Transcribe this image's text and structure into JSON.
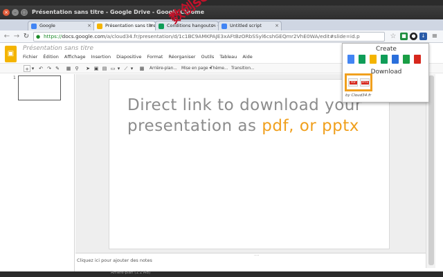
{
  "window": {
    "title": "Présentation sans titre - Google Drive - Google Chrome",
    "controls": [
      "×",
      "–",
      "□"
    ]
  },
  "tabs": [
    {
      "label": "Google",
      "favicon_color": "#4285f4",
      "close": "×"
    },
    {
      "label": "Présentation sans titre - G",
      "favicon_color": "#f4b400",
      "close": "×",
      "active": true
    },
    {
      "label": "Conditions hangouts - Go",
      "favicon_color": "#0f9d58",
      "close": "×"
    },
    {
      "label": "Untitled script",
      "favicon_color": "#4285f4",
      "close": "×"
    }
  ],
  "address_bar": {
    "scheme": "https://",
    "host": "docs.google.com",
    "path": "/a/cloud34.fr/presentation/d/1c1BC9AMKPAJE3xAFtBzORbSSyl6cshGEQmr2VhE0WA/edit#slide=id.p",
    "star": "☆",
    "menu": "≡"
  },
  "docs": {
    "title": "Présentation sans titre",
    "menu": [
      "Fichier",
      "Édition",
      "Affichage",
      "Insertion",
      "Diapositive",
      "Format",
      "Réorganiser",
      "Outils",
      "Tableau",
      "Aide"
    ],
    "toolbar_text": {
      "background": "Arrière-plan...",
      "layout": "Mise en page ▾",
      "theme": "Thème...",
      "transition": "Transition..."
    },
    "slide_number": "1",
    "slide_text_main": "Direct link to download your presentation as ",
    "slide_text_formats": "pdf, or pptx",
    "notes_placeholder": "Cliquez ici pour ajouter des notes",
    "notes_grip": "...."
  },
  "extension_popup": {
    "create_label": "Create",
    "download_label": "Download",
    "footer": "by Cloud34.fr",
    "create_icons": [
      {
        "name": "docs-icon",
        "color": "#4285f4"
      },
      {
        "name": "sheets-icon",
        "color": "#0f9d58"
      },
      {
        "name": "slides-icon",
        "color": "#f4b400"
      },
      {
        "name": "sheets2-icon",
        "color": "#0f9d58"
      },
      {
        "name": "arrow-icon",
        "color": "#2a6fdb"
      },
      {
        "name": "drawings-icon",
        "color": "#1a9e45"
      },
      {
        "name": "pdf-icon",
        "color": "#d7271d"
      }
    ],
    "download_formats": [
      "PDF",
      "PPTX"
    ],
    "highlight_color": "#f0a01e"
  },
  "watermark": "数创sc566",
  "status_text": "Arrière-plan (1.1 Mo)",
  "colors": {
    "accent": "#f0a01e",
    "slide_text": "#8c8c8c",
    "slides_brand": "#f4b400"
  }
}
